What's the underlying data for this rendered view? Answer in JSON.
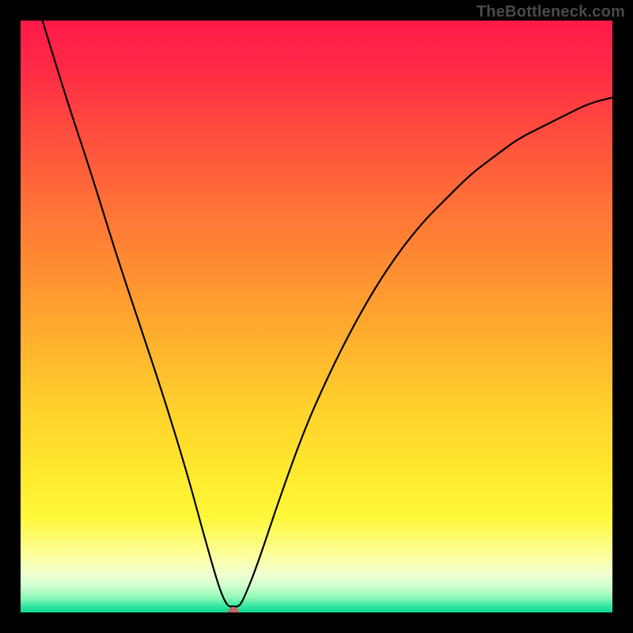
{
  "watermark": "TheBottleneck.com",
  "colors": {
    "marker": "#c06a6a",
    "curve": "#000000",
    "frame": "#000000"
  },
  "gradient_stops": [
    {
      "offset": 0.0,
      "color": "#ff1a4a"
    },
    {
      "offset": 0.08,
      "color": "#ff2a46"
    },
    {
      "offset": 0.18,
      "color": "#ff4a3e"
    },
    {
      "offset": 0.3,
      "color": "#ff6e38"
    },
    {
      "offset": 0.42,
      "color": "#ff8e32"
    },
    {
      "offset": 0.54,
      "color": "#ffb02e"
    },
    {
      "offset": 0.66,
      "color": "#ffd22c"
    },
    {
      "offset": 0.76,
      "color": "#ffe82e"
    },
    {
      "offset": 0.84,
      "color": "#fff83a"
    },
    {
      "offset": 0.905,
      "color": "#fbffa0"
    },
    {
      "offset": 0.935,
      "color": "#f0ffd0"
    },
    {
      "offset": 0.955,
      "color": "#d0ffd0"
    },
    {
      "offset": 0.975,
      "color": "#90f8b8"
    },
    {
      "offset": 0.99,
      "color": "#30e6a0"
    },
    {
      "offset": 1.0,
      "color": "#0fd890"
    }
  ],
  "chart_data": {
    "type": "line",
    "title": "",
    "xlabel": "",
    "ylabel": "",
    "xlim": [
      0,
      100
    ],
    "ylim": [
      0,
      100
    ],
    "optimum_x": 35,
    "marker": {
      "x": 36,
      "y": 0
    },
    "series": [
      {
        "name": "bottleneck-curve",
        "x": [
          0,
          4,
          8,
          12,
          16,
          20,
          24,
          28,
          31,
          33,
          34,
          35,
          36,
          37,
          38,
          40,
          44,
          48,
          52,
          56,
          60,
          64,
          68,
          72,
          76,
          80,
          84,
          88,
          92,
          96,
          100
        ],
        "y": [
          112,
          99,
          86,
          74,
          61,
          49,
          37,
          24,
          13,
          6,
          3,
          1,
          1,
          1,
          3,
          8,
          20,
          31,
          40,
          48,
          55,
          61,
          66,
          70,
          74,
          77,
          80,
          82,
          84,
          86,
          87
        ]
      }
    ]
  }
}
